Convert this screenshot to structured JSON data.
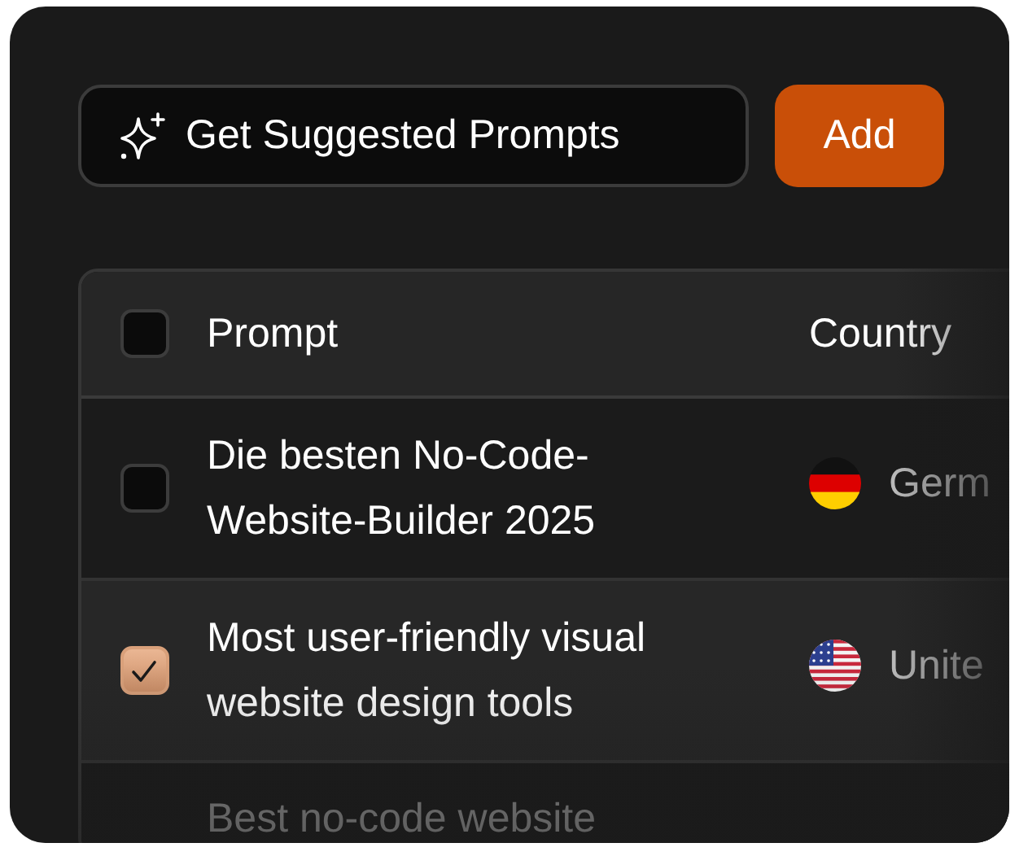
{
  "toolbar": {
    "suggest_button": "Get Suggested Prompts",
    "add_button": "Add"
  },
  "table": {
    "columns": [
      {
        "label": "Prompt"
      },
      {
        "label": "Country"
      }
    ],
    "header_checked": false,
    "rows": [
      {
        "prompt": "Die besten No-Code-Website-Builder 2025",
        "country": "Germ",
        "flag": {
          "kind": "germany"
        },
        "checked": false
      },
      {
        "prompt": "Most user-friendly visual website design tools",
        "country": "Unite",
        "flag": {
          "kind": "usa"
        },
        "checked": true
      },
      {
        "prompt": "Best no-code website"
      }
    ]
  }
}
